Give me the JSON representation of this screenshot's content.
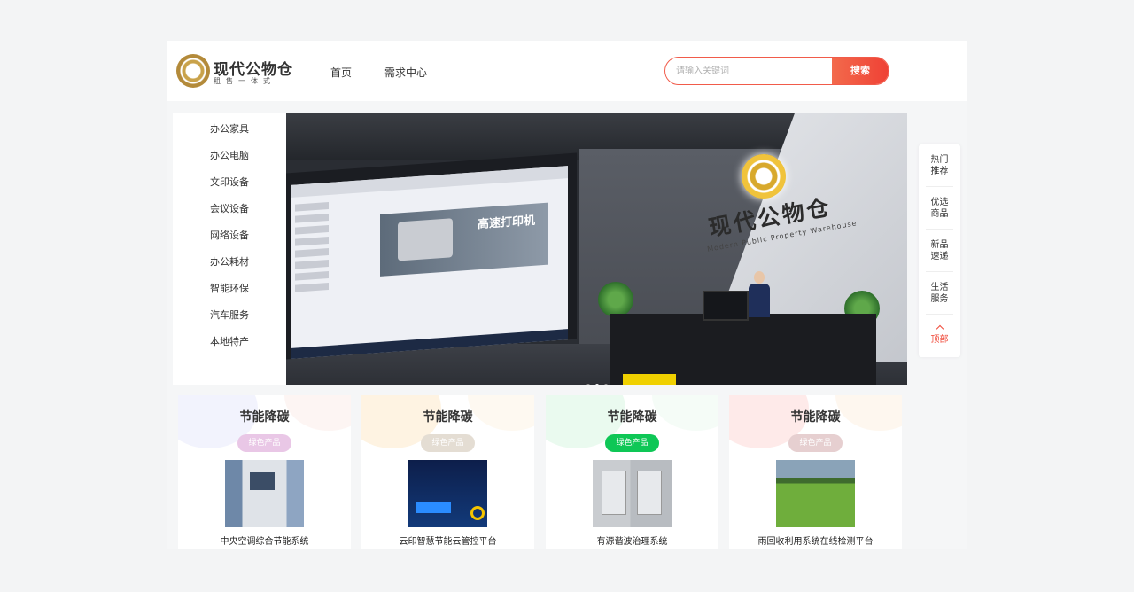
{
  "header": {
    "logo_name": "现代公物仓",
    "logo_sub": "租售一体式",
    "nav": [
      "首页",
      "需求中心"
    ],
    "search_placeholder": "请输入关键词",
    "search_button": "搜索"
  },
  "categories": [
    "办公家具",
    "办公电脑",
    "文印设备",
    "会议设备",
    "网络设备",
    "办公耗材",
    "智能环保",
    "汽车服务",
    "本地特产"
  ],
  "banner": {
    "brand_text": "现代公物仓",
    "brand_sub": "Modern Public Property Warehouse",
    "screen_ad": "高速打印机",
    "active_slide": 2,
    "slide_count": 3
  },
  "float_bar": {
    "items": [
      [
        "热门",
        "推荐"
      ],
      [
        "优选",
        "商品"
      ],
      [
        "新品",
        "速递"
      ],
      [
        "生活",
        "服务"
      ]
    ],
    "top_label": "顶部"
  },
  "cards": [
    {
      "title": "节能降碳",
      "tag": "绿色产品",
      "tag_color": "#e9c7e6",
      "blob_a": "#e6e8fb",
      "blob_b": "#fbe7e2",
      "name": "中央空调综合节能系统"
    },
    {
      "title": "节能降碳",
      "tag": "绿色产品",
      "tag_color": "#e4ddd3",
      "blob_a": "#fde7c6",
      "blob_b": "#fdf0dd",
      "name": "云印智慧节能云管控平台"
    },
    {
      "title": "节能降碳",
      "tag": "绿色产品",
      "tag_color": "#0ec756",
      "blob_a": "#d6f6df",
      "blob_b": "#e6f8ea",
      "name": "有源谐波治理系统"
    },
    {
      "title": "节能降碳",
      "tag": "绿色产品",
      "tag_color": "#e6cfd0",
      "blob_a": "#fdd6d4",
      "blob_b": "#fdebd8",
      "name": "雨回收利用系统在线检测平台"
    }
  ]
}
